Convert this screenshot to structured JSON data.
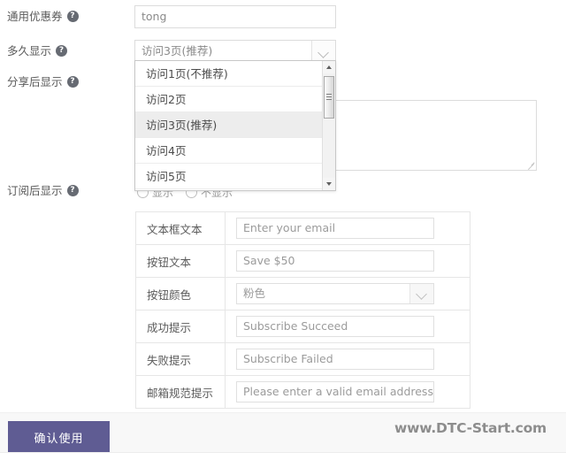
{
  "form": {
    "rows": [
      {
        "label": "通用优惠券",
        "help": "help-icon"
      },
      {
        "label": "多久显示",
        "help": "help-icon"
      },
      {
        "label": "分享后显示",
        "help": "help-icon"
      },
      {
        "label": "订阅后显示",
        "help": "help-icon"
      }
    ],
    "coupon_input_value": "tong",
    "coupon_input_placeholder": "",
    "duration_select_value": "访问3页(推荐)",
    "share_textarea_value": "",
    "share_textarea_placeholder": "",
    "subscribe_radios": [
      {
        "label": "显示",
        "checked": false
      },
      {
        "label": "不显示",
        "checked": false
      }
    ]
  },
  "dropdown": {
    "open": true,
    "options": [
      {
        "label": "访问1页(不推荐)",
        "selected": false
      },
      {
        "label": "访问2页",
        "selected": false
      },
      {
        "label": "访问3页(推荐)",
        "selected": true
      },
      {
        "label": "访问4页",
        "selected": false
      },
      {
        "label": "访问5页",
        "selected": false
      }
    ]
  },
  "settings_table": {
    "rows": [
      {
        "key": "文本框文本",
        "type": "input",
        "value": "Enter your email"
      },
      {
        "key": "按钮文本",
        "type": "input",
        "value": "Save $50"
      },
      {
        "key": "按钮颜色",
        "type": "select",
        "value": "粉色"
      },
      {
        "key": "成功提示",
        "type": "input",
        "value": "Subscribe Succeed"
      },
      {
        "key": "失败提示",
        "type": "input",
        "value": "Subscribe Failed"
      },
      {
        "key": "邮箱规范提示",
        "type": "input",
        "value": "Please enter a valid email address"
      }
    ]
  },
  "footer": {
    "confirm_label": "确认使用",
    "watermark": "www.DTC-Start.com"
  },
  "colors": {
    "button_purple": "#5f5c93",
    "footer_bg": "#f8f8f8",
    "border": "#dcdcdc",
    "help_icon": "#666a72",
    "selected_option_bg": "#ededed"
  }
}
